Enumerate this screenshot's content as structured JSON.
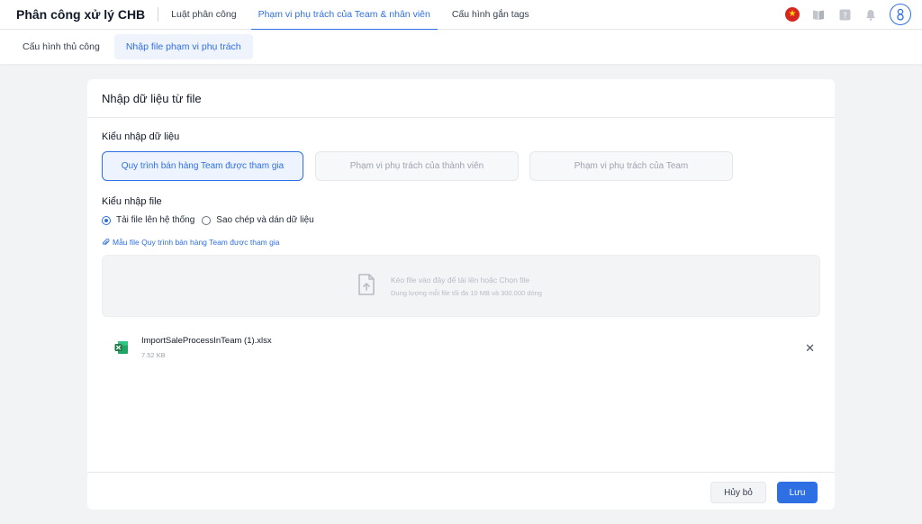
{
  "app": {
    "title": "Phân công xử lý CHB"
  },
  "nav": {
    "tabs": [
      {
        "label": "Luật phân công",
        "active": false
      },
      {
        "label": "Phạm vi phụ trách của Team & nhân viên",
        "active": true
      },
      {
        "label": "Cấu hình gắn tags",
        "active": false
      }
    ]
  },
  "topbar_icons": [
    "vietnam-flag-icon",
    "book-icon",
    "help-icon",
    "bell-icon",
    "user-avatar-icon"
  ],
  "subtabs": [
    {
      "label": "Cấu hình thủ công",
      "active": false
    },
    {
      "label": "Nhập file phạm vi phụ trách",
      "active": true
    }
  ],
  "card": {
    "title": "Nhập dữ liệu từ file",
    "import_type": {
      "label": "Kiểu nhập dữ liệu",
      "options": [
        {
          "label": "Quy trình bán hàng Team được tham gia",
          "active": true
        },
        {
          "label": "Phạm vi phụ trách của thành viên",
          "active": false
        },
        {
          "label": "Phạm vi phụ trách của Team",
          "active": false
        }
      ]
    },
    "file_type": {
      "label": "Kiểu nhập file",
      "radios": [
        {
          "label": "Tải file lên hệ thống",
          "checked": true
        },
        {
          "label": "Sao chép và dán dữ liệu",
          "checked": false
        }
      ]
    },
    "template_link": "Mẫu file Quy trình bán hàng Team được tham gia",
    "dropzone": {
      "main": "Kéo file vào đây để tải lên hoặc Chọn file",
      "sub": "Dung lượng mỗi file tối đa 10 MB và 300.000 dòng"
    },
    "file": {
      "name": "ImportSaleProcessInTeam (1).xlsx",
      "size": "7.52 KB"
    },
    "footer": {
      "cancel": "Hủy bỏ",
      "save": "Lưu"
    }
  },
  "colors": {
    "accent": "#2f6fe4",
    "excel": "#1d7a45",
    "background": "#f2f3f5"
  }
}
